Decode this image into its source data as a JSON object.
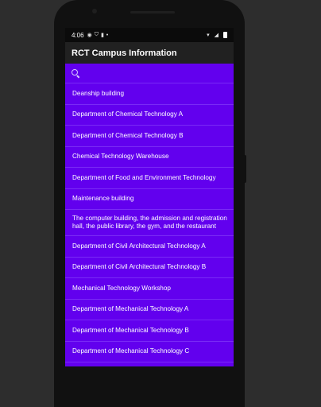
{
  "status_bar": {
    "time": "4:06",
    "icons": [
      "circle-icon",
      "shield-icon",
      "mic-icon",
      "dot-icon"
    ],
    "right_icons": [
      "wifi-icon",
      "signal-icon",
      "battery-icon"
    ]
  },
  "app_bar": {
    "title": "RCT Campus Information"
  },
  "search": {
    "icon": "search-icon"
  },
  "list": {
    "items": [
      "Deanship building",
      "Department of Chemical Technology A",
      "Department of Chemical Technology B",
      "Chemical Technology Warehouse",
      "Department of Food and Environment Technology",
      "Maintenance building",
      "The computer building, the admission and registration hall, the public library, the gym, and the restaurant",
      "Department of Civil Architectural Technology A",
      "Department of Civil Architectural Technology B",
      "Mechanical Technology Workshop",
      "Department of Mechanical Technology A",
      "Department of Mechanical Technology B",
      "Department of Mechanical Technology C"
    ]
  },
  "colors": {
    "primary": "#6200ee",
    "app_bar": "#212121",
    "background": "#2d2d2d"
  }
}
